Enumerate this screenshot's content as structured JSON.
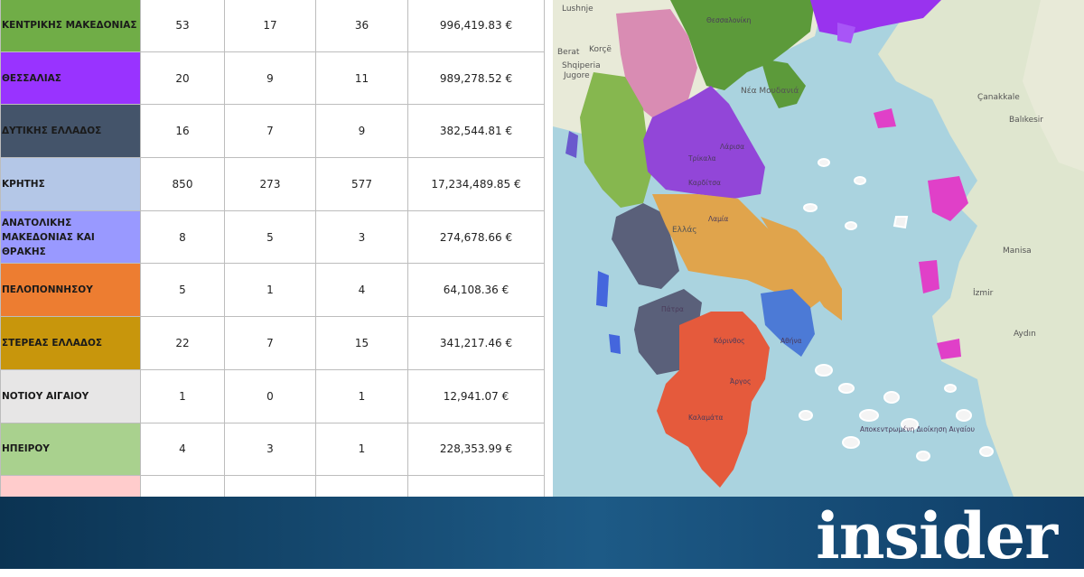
{
  "table": {
    "rows": [
      {
        "region": "ΚΕΝΤΡΙΚΗΣ  ΜΑΚΕΔΟΝΙΑΣ",
        "c1": "53",
        "c2": "17",
        "c3": "36",
        "amount": "996,419.83 €",
        "color": "#70ad47"
      },
      {
        "region": "ΘΕΣΣΑΛΙΑΣ",
        "c1": "20",
        "c2": "9",
        "c3": "11",
        "amount": "989,278.52 €",
        "color": "#9933ff"
      },
      {
        "region": "ΔΥΤΙΚΗΣ ΕΛΛΑΔΟΣ",
        "c1": "16",
        "c2": "7",
        "c3": "9",
        "amount": "382,544.81 €",
        "color": "#44546a"
      },
      {
        "region": "ΚΡΗΤΗΣ",
        "c1": "850",
        "c2": "273",
        "c3": "577",
        "amount": "17,234,489.85 €",
        "color": "#b4c7e7"
      },
      {
        "region": "ΑΝΑΤΟΛΙΚΗΣ ΜΑΚΕΔΟΝΙΑΣ ΚΑΙ ΘΡΑΚΗΣ",
        "c1": "8",
        "c2": "5",
        "c3": "3",
        "amount": "274,678.66 €",
        "color": "#9999ff"
      },
      {
        "region": "ΠΕΛΟΠΟΝΝΗΣΟΥ",
        "c1": "5",
        "c2": "1",
        "c3": "4",
        "amount": "64,108.36 €",
        "color": "#ed7d31"
      },
      {
        "region": "ΣΤΕΡΕΑΣ ΕΛΛΑΔΟΣ",
        "c1": "22",
        "c2": "7",
        "c3": "15",
        "amount": "341,217.46 €",
        "color": "#c8960c"
      },
      {
        "region": "ΝΟΤΙΟΥ ΑΙΓΑΙΟΥ",
        "c1": "1",
        "c2": "0",
        "c3": "1",
        "amount": "12,941.07 €",
        "color": "#e7e6e6"
      },
      {
        "region": "ΗΠΕΙΡΟΥ",
        "c1": "4",
        "c2": "3",
        "c3": "1",
        "amount": "228,353.99 €",
        "color": "#a9d18e"
      },
      {
        "region": "",
        "c1": "",
        "c2": "",
        "c3": "",
        "amount": "",
        "color": "#ffcccc"
      }
    ]
  },
  "map": {
    "labels": [
      "Lushnje",
      "Berat",
      "Korçë",
      "Shqiperia",
      "Jugore",
      "Θεσσαλονίκη",
      "Νέα Μουδανιά",
      "Λάρισα",
      "Τρίκαλα",
      "Καρδίτσα",
      "Ελλάς",
      "Λαμία",
      "Αθήνα",
      "Πάτρα",
      "Κόρινθος",
      "Άργος",
      "Καλαμάτα",
      "Balıkesir",
      "Çanakkale",
      "Manisa",
      "İzmir",
      "Aydın",
      "Αποκεντρωμένη Διοίκηση Αιγαίου"
    ],
    "colors": {
      "sea": "#aad3df",
      "land": "#e8ead8",
      "turkey": "#dfe6cf"
    }
  },
  "brand": {
    "logo": "insider"
  }
}
